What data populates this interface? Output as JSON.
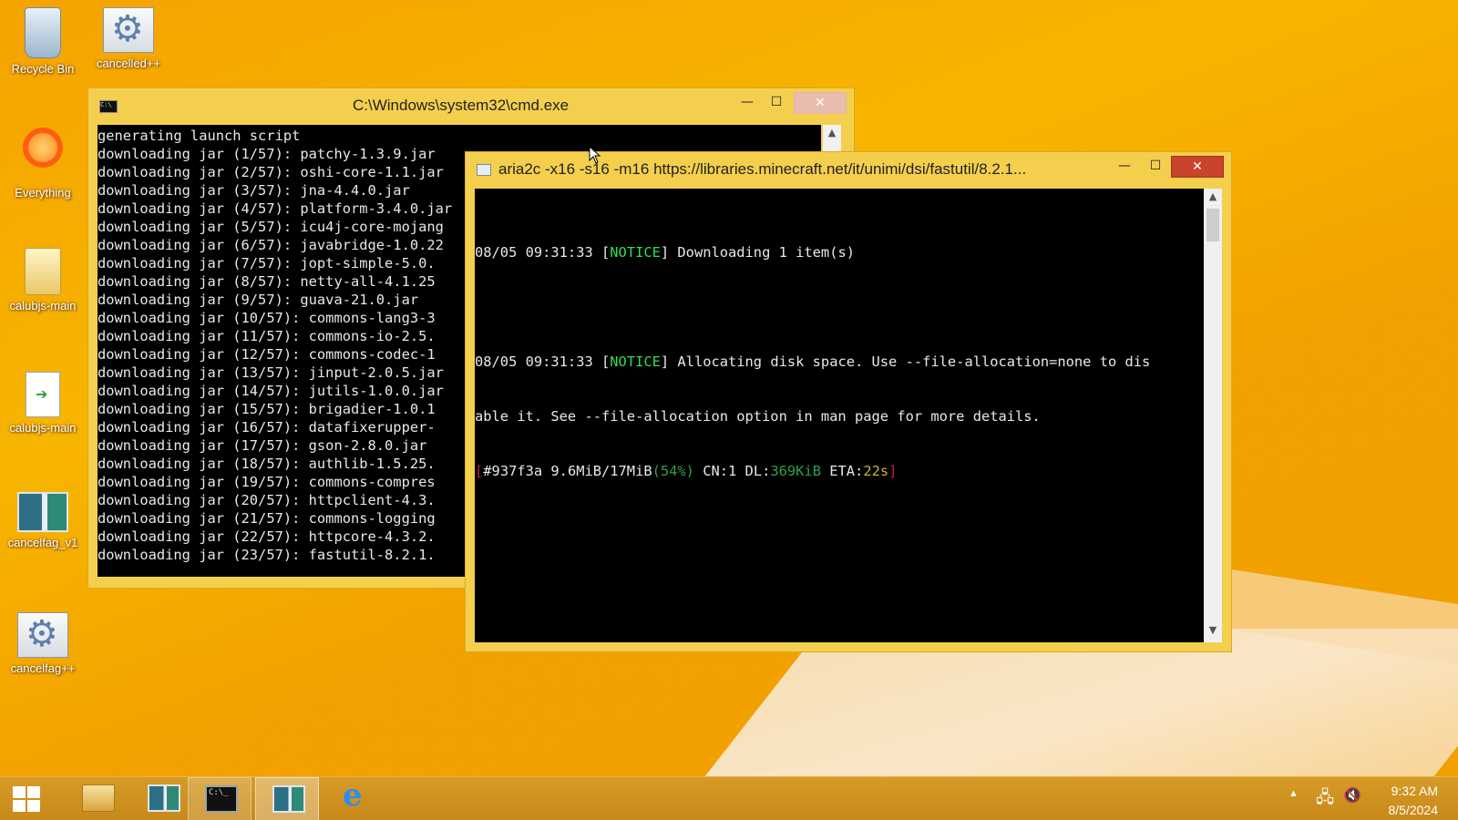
{
  "desktop": {
    "icons": [
      {
        "label": "Recycle Bin",
        "icon": "recycle-bin-icon"
      },
      {
        "label": "cancelled++",
        "icon": "gear-document-icon"
      },
      {
        "label": "Everything",
        "icon": "everything-search-icon"
      },
      {
        "label": "calubjs-main",
        "icon": "folder-icon"
      },
      {
        "label": "calubjs-main",
        "icon": "shortcut-file-icon"
      },
      {
        "label": "cancelfag_v1",
        "icon": "app-icon"
      },
      {
        "label": "cancelfag++",
        "icon": "gear-document-icon"
      }
    ]
  },
  "cmd_window": {
    "title": "C:\\Windows\\system32\\cmd.exe",
    "lines": [
      "generating launch script",
      "downloading jar (1/57): patchy-1.3.9.jar",
      "downloading jar (2/57): oshi-core-1.1.jar",
      "downloading jar (3/57): jna-4.4.0.jar",
      "downloading jar (4/57): platform-3.4.0.jar",
      "downloading jar (5/57): icu4j-core-mojang",
      "downloading jar (6/57): javabridge-1.0.22",
      "downloading jar (7/57): jopt-simple-5.0.",
      "downloading jar (8/57): netty-all-4.1.25",
      "downloading jar (9/57): guava-21.0.jar",
      "downloading jar (10/57): commons-lang3-3",
      "downloading jar (11/57): commons-io-2.5.",
      "downloading jar (12/57): commons-codec-1",
      "downloading jar (13/57): jinput-2.0.5.jar",
      "downloading jar (14/57): jutils-1.0.0.jar",
      "downloading jar (15/57): brigadier-1.0.1",
      "downloading jar (16/57): datafixerupper-",
      "downloading jar (17/57): gson-2.8.0.jar",
      "downloading jar (18/57): authlib-1.5.25.",
      "downloading jar (19/57): commons-compres",
      "downloading jar (20/57): httpclient-4.3.",
      "downloading jar (21/57): commons-logging",
      "downloading jar (22/57): httpcore-4.3.2.",
      "downloading jar (23/57): fastutil-8.2.1."
    ]
  },
  "aria_window": {
    "title": "aria2c  -x16 -s16 -m16 https://libraries.minecraft.net/it/unimi/dsi/fastutil/8.2.1...",
    "line1_prefix": "08/05 09:31:33 [",
    "line1_notice": "NOTICE",
    "line1_suffix": "] Downloading 1 item(s)",
    "line2_prefix": "08/05 09:31:33 [",
    "line2_notice": "NOTICE",
    "line2_suffix": "] Allocating disk space. Use --file-allocation=none to dis",
    "line3": "able it. See --file-allocation option in man page for more details.",
    "status_open": "[",
    "status_id": "#937f3a 9.6MiB/17MiB",
    "status_pct": "(54%)",
    "status_cn": " CN:1 DL:",
    "status_dl": "369KiB",
    "status_eta_label": " ETA:",
    "status_eta": "22s",
    "status_close": "]"
  },
  "taskbar": {
    "items": [
      "start-button",
      "file-explorer",
      "app",
      "command-prompt",
      "app-active",
      "internet-explorer"
    ],
    "clock_time": "9:32 AM",
    "clock_date": "8/5/2024"
  },
  "colors": {
    "notice": "#2de04a",
    "status_red": "#c01f4f",
    "status_green": "#2da24a",
    "status_yellow": "#c6b72a",
    "window_frame": "#f4cf4d",
    "close_button": "#c9442c"
  }
}
